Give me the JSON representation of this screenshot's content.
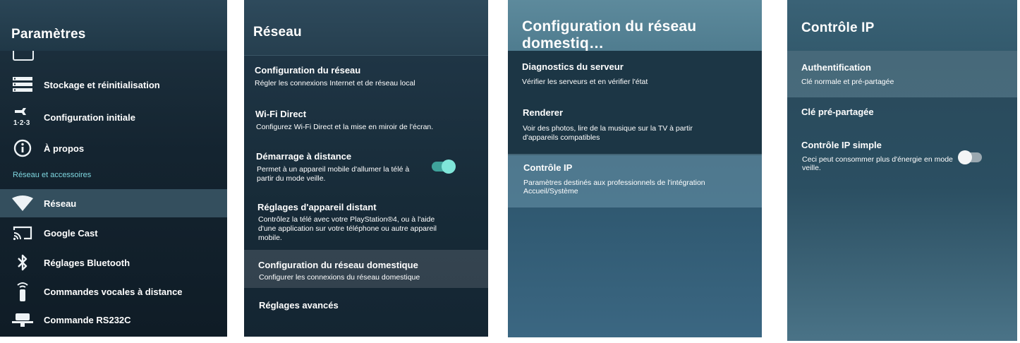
{
  "panel1": {
    "title": "Paramètres",
    "items": [
      {
        "label": "Stockage et réinitialisation",
        "icon": "storage-icon"
      },
      {
        "label": "Configuration initiale",
        "icon": "initial-setup-icon"
      },
      {
        "label": "À propos",
        "icon": "info-icon"
      }
    ],
    "section": "Réseau et accessoires",
    "section_items": [
      {
        "label": "Réseau",
        "icon": "wifi-icon"
      },
      {
        "label": "Google Cast",
        "icon": "cast-icon"
      },
      {
        "label": "Réglages Bluetooth",
        "icon": "bluetooth-icon"
      },
      {
        "label": "Commandes vocales à distance",
        "icon": "remote-icon"
      },
      {
        "label": "Commande RS232C",
        "icon": "serial-port-icon"
      }
    ]
  },
  "panel2": {
    "title": "Réseau",
    "options": [
      {
        "title": "Configuration du réseau",
        "desc": "Régler les connexions Internet et de réseau local"
      },
      {
        "title": "Wi-Fi Direct",
        "desc": "Configurez Wi-Fi Direct et la mise en miroir de l'écran."
      },
      {
        "title": "Démarrage à distance",
        "desc1": "Permet à un appareil mobile d'allumer la télé à",
        "desc2": "partir du mode veille.",
        "toggle": "on"
      },
      {
        "title": "Réglages d'appareil distant",
        "desc1": "Contrôlez la télé avec votre PlayStation®4, ou à l'aide",
        "desc2": "d'une application sur votre téléphone ou autre appareil",
        "desc3": "mobile."
      },
      {
        "title": "Configuration du réseau domestique",
        "desc": "Configurer les connexions du réseau domestique"
      },
      {
        "title": "Réglages avancés"
      }
    ]
  },
  "panel3": {
    "title": "Configuration du réseau domestiq…",
    "options": [
      {
        "title": "Diagnostics du serveur",
        "desc": "Vérifier les serveurs et en vérifier l'état"
      },
      {
        "title": "Renderer",
        "desc1": "Voir des photos, lire de la musique sur la TV à partir",
        "desc2": "d'appareils compatibles"
      },
      {
        "title": "Contrôle IP",
        "desc1": "Paramètres destinés aux professionnels de l'intégration",
        "desc2": "Accueil/Système"
      }
    ]
  },
  "panel4": {
    "title": "Contrôle IP",
    "options": [
      {
        "title": "Authentification",
        "desc": "Clé normale et pré-partagée"
      },
      {
        "title": "Clé pré-partagée"
      },
      {
        "title": "Contrôle IP simple",
        "desc1": "Ceci peut consommer plus d'énergie en mode",
        "desc2": "veille.",
        "toggle": "off"
      }
    ]
  },
  "colors": {
    "accent": "#7fe6d9",
    "section_label": "#7fd7e0"
  }
}
